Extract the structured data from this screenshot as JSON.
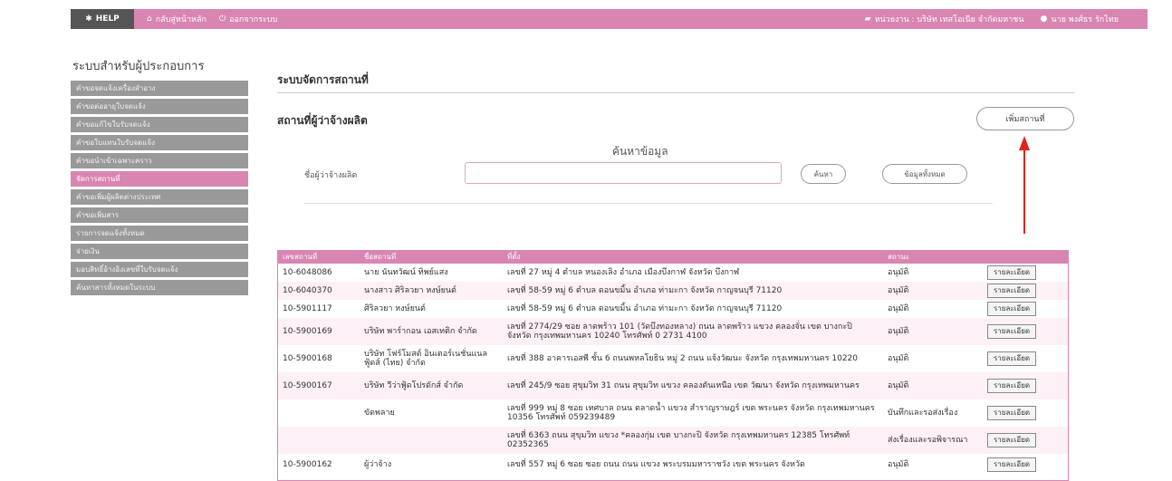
{
  "topbar": {
    "help_label": "HELP",
    "home_label": "กลับสู่หน้าหลัก",
    "logout_label": "ออกจากระบบ",
    "agency_label": "หน่วยงาน : บริษัท เทสโอเนีย จำกัดมหาชน",
    "user_label": "นาย พงศ์ธร รักไทย"
  },
  "sidebar": {
    "title": "ระบบสำหรับผู้ประกอบการ",
    "items": [
      {
        "label": "คำขอจดแจ้งเครื่องสำอาง"
      },
      {
        "label": "คำขอต่ออายุใบจดแจ้ง"
      },
      {
        "label": "คำขอแก้ไขใบรับจดแจ้ง"
      },
      {
        "label": "คำขอใบแทนใบรับจดแจ้ง"
      },
      {
        "label": "คำขอนำเข้าเฉพาะคราว"
      },
      {
        "label": "จัดการสถานที่"
      },
      {
        "label": "คำขอเพิ่มผู้ผลิตต่างประเทศ"
      },
      {
        "label": "คำขอเพิ่มสาร"
      },
      {
        "label": "รายการจดแจ้งทั้งหมด"
      },
      {
        "label": "จ่ายเงิน"
      },
      {
        "label": "มอบสิทธิ์อ้างอิงเลขที่ใบรับจดแจ้ง"
      },
      {
        "label": "ค้นหาสารทั้งหมดในระบบ"
      }
    ],
    "active_index": 5
  },
  "main": {
    "page_title": "ระบบจัดการสถานที่",
    "section_title": "สถานที่ผู้ว่าจ้างผลิต",
    "add_button": "เพิ่มสถานที่",
    "search": {
      "heading": "ค้นหาข้อมูล",
      "label": "ชื่อผู้ว่าจ้างผลิต",
      "input_value": "",
      "search_button": "ค้นหา",
      "all_button": "ข้อมูลทั้งหมด"
    }
  },
  "table": {
    "headers": [
      "เลขสถานที่",
      "ชื่อสถานที่",
      "ที่ตั้ง",
      "สถานะ",
      ""
    ],
    "detail_label": "รายละเอียด",
    "rows": [
      {
        "code": "10-6048086",
        "name": "นาย นันทวัฒน์ ทิพย์แสง",
        "address": "เลขที่ 27 หมู่ 4 ตำบล หนองเลิง อำเภอ เมืองบึงกาฬ จังหวัด บึงกาฬ",
        "status": "อนุมัติ"
      },
      {
        "code": "10-6040370",
        "name": "นางสาว ศิริลวยา หงษ์ยนต์",
        "address": "เลขที่ 58-59 หมู่ 6 ตำบล ดอนขมิ้น อำเภอ ท่ามะกา จังหวัด กาญจนบุรี 71120",
        "status": "อนุมัติ"
      },
      {
        "code": "10-5901117",
        "name": "ศิริลวยา หงษ์ยนต์",
        "address": "เลขที่ 58-59 หมู่ 6 ตำบล ดอนขมิ้น อำเภอ ท่ามะกา จังหวัด กาญจนบุรี 71120",
        "status": "อนุมัติ"
      },
      {
        "code": "10-5900169",
        "name": "บริษัท พาร์ากอน เอสเทติก จำกัด",
        "address": "เลขที่ 2774/29 ซอย ลาดพร้าว 101 (วัดบึงทองหลาง) ถนน ลาดพร้าว แขวง คลองจั่น เขต บางกะปิ จังหวัด กรุงเทพมหานคร 10240 โทรศัพท์ 0 2731 4100",
        "status": "อนุมัติ"
      },
      {
        "code": "10-5900168",
        "name": "บริษัท โฟร์โมสต์ อินเตอร์เนชั่นแนล ฟู้ดส์ (ไทย) จำกัด",
        "address": "เลขที่ 388 อาคารเอสพี ชั้น 6 ถนนพหลโยธิน หมู่ 2 ถนน แจ้งวัฒนะ จังหวัด กรุงเทพมหานคร 10220",
        "status": "อนุมัติ"
      },
      {
        "code": "10-5900167",
        "name": "บริษัท วีว่าฟู้ดโปรดักส์ จำกัด",
        "address": "เลขที่ 245/9 ซอย สุขุมวิท 31 ถนน สุขุมวิท แขวง คลองตันเหนือ เขต วัฒนา จังหวัด กรุงเทพมหานคร",
        "status": "อนุมัติ"
      },
      {
        "code": "",
        "name": "ขัดพลาย",
        "address": "เลขที่ 999 หมู่ 8 ซอย เทศบาล ถนน ตลาดน้ำ แขวง สำราญราษฎร์ เขต พระนคร จังหวัด กรุงเทพมหานคร 10356 โทรศัพท์ 059239489",
        "status": "บันทึกและรอส่งเรื่อง"
      },
      {
        "code": "",
        "name": "",
        "address": "เลขที่ 6363 ถนน สุขุมวิท แขวง *คลองกุ่ม เขต บางกะปิ จังหวัด กรุงเทพมหานคร 12385 โทรศัพท์ 02352365",
        "status": "ส่งเรื่องและรอพิจารณา"
      },
      {
        "code": "10-5900162",
        "name": "ผู้ว่าจ้าง",
        "address": "เลขที่ 557 หมู่ 6 ซอย ซอย ถนน ถนน แขวง พระบรมมหาราชวัง เขต พระนคร จังหวัด",
        "status": "อนุมัติ"
      }
    ]
  },
  "colors": {
    "accent_pink": "#d985b1",
    "sidebar_gray": "#999999",
    "arrow_red": "#d9251c"
  }
}
